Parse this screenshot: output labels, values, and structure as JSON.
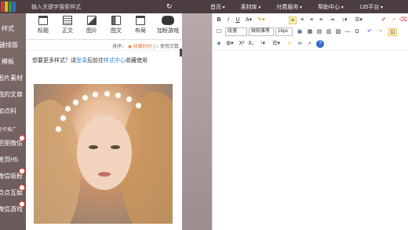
{
  "topbar": {
    "search_placeholder": "输入关键字搜索样式",
    "refresh_icon": "↻",
    "nav": [
      "首页",
      "素材库",
      "付费服务",
      "帮助中心",
      "135平台"
    ]
  },
  "sidebar": {
    "items": [
      "样式",
      "键排版",
      "模板",
      "图片素材",
      "我的文章",
      "加点料"
    ],
    "section": "合作推广",
    "promo": [
      "吧朋微信",
      "黄页H5",
      "微信吸粉",
      "点点互娱",
      "微信游戏"
    ]
  },
  "tools": {
    "tabs": [
      "标题",
      "正文",
      "图片",
      "图文",
      "布局",
      "加粉游戏"
    ],
    "sort_label": "排序：",
    "sort_selected": "收藏时间",
    "sort_other": "使用次数",
    "hint_prefix": "想要更多样式？请",
    "hint_login": "登录",
    "hint_mid": "后前往",
    "hint_link": "样式中心",
    "hint_suffix": "收藏使用"
  },
  "editor": {
    "font_style": "段落",
    "font_family": "微软雅黑",
    "font_size": "16px"
  },
  "colors": {
    "topbar": "#4c3d40",
    "sidebar": "#7e6c6a",
    "accent_orange": "#e27b31",
    "link_blue": "#2b8ad8"
  }
}
